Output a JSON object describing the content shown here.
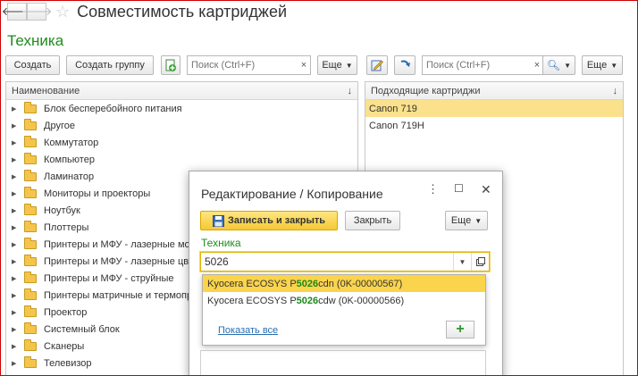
{
  "window": {
    "title": "Совместимость картриджей"
  },
  "section": {
    "title": "Техника"
  },
  "toolbar_left": {
    "create": "Создать",
    "create_group": "Создать группу",
    "search_placeholder": "Поиск (Ctrl+F)",
    "clear": "×",
    "more": "Еще"
  },
  "toolbar_right": {
    "search_placeholder": "Поиск (Ctrl+F)",
    "clear": "×",
    "more": "Еще"
  },
  "tree": {
    "header": "Наименование",
    "sort_icon": "↓",
    "items": [
      "Блок бесперебойного питания",
      "Другое",
      "Коммутатор",
      "Компьютер",
      "Ламинатор",
      "Мониторы и проекторы",
      "Ноутбук",
      "Плоттеры",
      "Принтеры и МФУ - лазерные мо",
      "Принтеры и МФУ - лазерные цв",
      "Принтеры и МФУ - струйные",
      "Принтеры матричные и термопр",
      "Проектор",
      "Системный блок",
      "Сканеры",
      "Телевизор"
    ]
  },
  "cartridges": {
    "header": "Подходящие картриджи",
    "sort_icon": "↓",
    "items": [
      "Canon 719",
      "Canon 719H"
    ],
    "selected_index": 0
  },
  "dialog": {
    "title": "Редактирование / Копирование",
    "save_close": "Записать и закрыть",
    "close": "Закрыть",
    "more": "Еще",
    "field_label": "Техника",
    "field_value": "5026",
    "suggestions": [
      {
        "before": "Kyocera ECOSYS P",
        "match": "5026",
        "after": "cdn (0K-00000567)"
      },
      {
        "before": "Kyocera ECOSYS P",
        "match": "5026",
        "after": "cdw (0K-00000566)"
      }
    ],
    "selected_suggestion": 0,
    "show_all": "Показать все",
    "add": "+"
  },
  "colors": {
    "accent_green": "#1e8c1e",
    "selection_yellow": "#fbd44d",
    "row_selection": "#fbe18c",
    "frame_red": "#cc0000"
  },
  "icons": [
    "back-arrow-icon",
    "forward-arrow-icon",
    "favorite-star-icon",
    "add-document-icon",
    "edit-icon",
    "refresh-icon",
    "magnifier-icon",
    "folder-icon",
    "save-icon",
    "kebab-menu-icon",
    "maximize-icon",
    "close-icon",
    "open-item-icon"
  ]
}
